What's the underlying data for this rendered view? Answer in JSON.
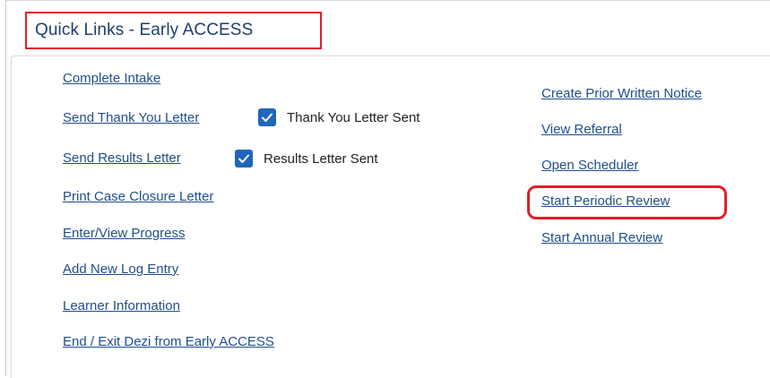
{
  "title": "Quick Links - Early ACCESS",
  "colors": {
    "link": "#1f4e8c",
    "title": "#1f3f6b",
    "highlight": "#e0202a",
    "checkbox": "#1f67b8"
  },
  "left_links": {
    "complete_intake": "Complete Intake",
    "send_thank_you": "Send Thank You Letter",
    "send_results": "Send Results Letter",
    "print_closure": "Print Case Closure Letter",
    "enter_progress": "Enter/View Progress",
    "add_log": "Add New Log Entry",
    "learner_info": "Learner Information",
    "end_exit": "End / Exit Dezi from Early ACCESS"
  },
  "checks": {
    "thank_you_sent": {
      "label": "Thank You Letter Sent",
      "checked": true
    },
    "results_sent": {
      "label": "Results Letter Sent",
      "checked": true
    }
  },
  "right_links": {
    "prior_written_notice": "Create Prior Written Notice",
    "view_referral": "View Referral",
    "open_scheduler": "Open Scheduler",
    "periodic_review": "Start Periodic Review",
    "annual_review": "Start Annual Review"
  },
  "icons": {
    "checkbox": "checkmark-icon"
  }
}
